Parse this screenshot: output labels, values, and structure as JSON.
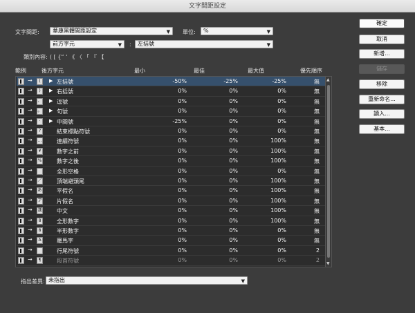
{
  "window": {
    "title": "文字間距設定"
  },
  "form": {
    "spacing_label": "文字間距:",
    "spacing_value": "華康黑體間距設定",
    "unit_label": "單位:",
    "unit_value": "%",
    "prev_char_value": "前方字元",
    "colon": ":",
    "next_char_value": "左括號",
    "class_label": "類別內容:",
    "class_chars": "( [ {“ ‘ 《 〈 「 『 【"
  },
  "buttons": {
    "ok": "確定",
    "cancel": "取消",
    "new": "新增...",
    "save": "儲存",
    "remove": "移除",
    "rename": "重新命名...",
    "load": "讀入...",
    "basic": "基本..."
  },
  "headers": {
    "example": "範例",
    "next_char": "後方字元",
    "min": "最小",
    "optimal": "最佳",
    "max": "最大值",
    "priority": "優先順序"
  },
  "rows": [
    {
      "glyph": "(",
      "name": "左括號",
      "expand": true,
      "min": "-50%",
      "opt": "-25%",
      "max": "-25%",
      "pri": "無",
      "sel": true,
      "dim": false
    },
    {
      "glyph": ")",
      "name": "右括號",
      "expand": true,
      "min": "0%",
      "opt": "0%",
      "max": "0%",
      "pri": "無",
      "sel": false,
      "dim": false
    },
    {
      "glyph": "、",
      "name": "逗號",
      "expand": true,
      "min": "0%",
      "opt": "0%",
      "max": "0%",
      "pri": "無",
      "sel": false,
      "dim": false
    },
    {
      "glyph": "。",
      "name": "句號",
      "expand": true,
      "min": "0%",
      "opt": "0%",
      "max": "0%",
      "pri": "無",
      "sel": false,
      "dim": false
    },
    {
      "glyph": "·",
      "name": "中間號",
      "expand": true,
      "min": "-25%",
      "opt": "0%",
      "max": "0%",
      "pri": "無",
      "sel": false,
      "dim": false
    },
    {
      "glyph": "?",
      "name": "結束標點符號",
      "expand": false,
      "min": "0%",
      "opt": "0%",
      "max": "0%",
      "pri": "無",
      "sel": false,
      "dim": false
    },
    {
      "glyph": "…",
      "name": "連續符號",
      "expand": false,
      "min": "0%",
      "opt": "0%",
      "max": "100%",
      "pri": "無",
      "sel": false,
      "dim": false
    },
    {
      "glyph": "¥",
      "name": "數字之前",
      "expand": false,
      "min": "0%",
      "opt": "0%",
      "max": "100%",
      "pri": "無",
      "sel": false,
      "dim": false
    },
    {
      "glyph": "%",
      "name": "數字之後",
      "expand": false,
      "min": "0%",
      "opt": "0%",
      "max": "100%",
      "pri": "無",
      "sel": false,
      "dim": false
    },
    {
      "glyph": "",
      "name": "全形空格",
      "expand": false,
      "min": "0%",
      "opt": "0%",
      "max": "0%",
      "pri": "無",
      "sel": false,
      "dim": false
    },
    {
      "glyph": "／",
      "name": "頂端避頭尾",
      "expand": false,
      "min": "0%",
      "opt": "0%",
      "max": "100%",
      "pri": "無",
      "sel": false,
      "dim": false
    },
    {
      "glyph": "あ",
      "name": "平假名",
      "expand": false,
      "min": "0%",
      "opt": "0%",
      "max": "100%",
      "pri": "無",
      "sel": false,
      "dim": false
    },
    {
      "glyph": "ア",
      "name": "片假名",
      "expand": false,
      "min": "0%",
      "opt": "0%",
      "max": "100%",
      "pri": "無",
      "sel": false,
      "dim": false
    },
    {
      "glyph": "漢",
      "name": "中文",
      "expand": false,
      "min": "0%",
      "opt": "0%",
      "max": "100%",
      "pri": "無",
      "sel": false,
      "dim": false
    },
    {
      "glyph": "8",
      "name": "全形數字",
      "expand": false,
      "min": "0%",
      "opt": "0%",
      "max": "100%",
      "pri": "無",
      "sel": false,
      "dim": false
    },
    {
      "glyph": "8",
      "name": "半形數字",
      "expand": false,
      "min": "0%",
      "opt": "0%",
      "max": "0%",
      "pri": "無",
      "sel": false,
      "dim": false
    },
    {
      "glyph": "A",
      "name": "羅馬字",
      "expand": false,
      "min": "0%",
      "opt": "0%",
      "max": "0%",
      "pri": "無",
      "sel": false,
      "dim": false
    },
    {
      "glyph": "",
      "name": "行尾符號",
      "expand": false,
      "min": "0%",
      "opt": "0%",
      "max": "0%",
      "pri": "2",
      "sel": false,
      "dim": false
    },
    {
      "glyph": "¶",
      "name": "段首符號",
      "expand": false,
      "min": "0%",
      "opt": "0%",
      "max": "0%",
      "pri": "2",
      "sel": false,
      "dim": true
    }
  ],
  "footer": {
    "label": "指出差異:",
    "value": "未指出"
  }
}
